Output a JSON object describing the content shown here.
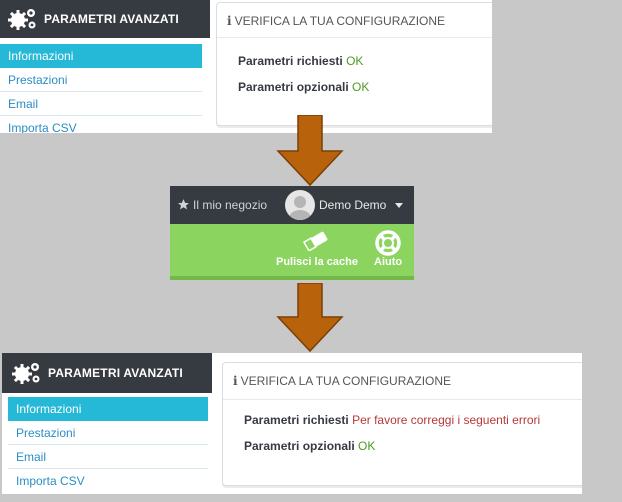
{
  "before": {
    "sidebar": {
      "title": "PARAMETRI AVANZATI",
      "items": [
        {
          "label": "Informazioni",
          "active": true
        },
        {
          "label": "Prestazioni",
          "active": false
        },
        {
          "label": "Email",
          "active": false
        },
        {
          "label": "Importa CSV",
          "active": false
        }
      ]
    },
    "panel": {
      "title": "VERIFICA LA TUA CONFIGURAZIONE",
      "required_label": "Parametri richiesti",
      "required_status": "OK",
      "optional_label": "Parametri opzionali",
      "optional_status": "OK"
    }
  },
  "toolbar": {
    "shop_link": "Il mio negozio",
    "user_name": "Demo Demo",
    "clear_cache": "Pulisci la cache",
    "help": "Aiuto"
  },
  "after": {
    "sidebar": {
      "title": "PARAMETRI AVANZATI",
      "items": [
        {
          "label": "Informazioni",
          "active": true
        },
        {
          "label": "Prestazioni",
          "active": false
        },
        {
          "label": "Email",
          "active": false
        },
        {
          "label": "Importa CSV",
          "active": false
        }
      ]
    },
    "panel": {
      "title": "VERIFICA LA TUA CONFIGURAZIONE",
      "required_label": "Parametri richiesti",
      "required_status": "Per favore correggi i seguenti errori",
      "optional_label": "Parametri opzionali",
      "optional_status": "OK"
    }
  },
  "colors": {
    "sidebar_header": "#363a41",
    "active_item": "#25b9d7",
    "link": "#2a8ec6",
    "ok": "#4d9a25",
    "error": "#b83838",
    "toolbar_green": "#8bd45f",
    "arrow": "#b8620c"
  },
  "icons": [
    "gears-icon",
    "info-icon",
    "star-icon",
    "avatar",
    "caret-down-icon",
    "eraser-icon",
    "lifebuoy-icon",
    "arrow-down-icon"
  ]
}
